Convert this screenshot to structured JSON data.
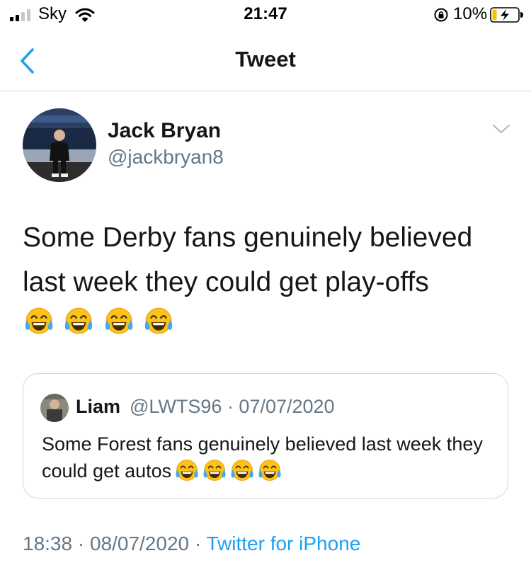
{
  "status_bar": {
    "carrier": "Sky",
    "time": "21:47",
    "battery_percent": "10%",
    "signal_bars": 2,
    "charging": true
  },
  "nav": {
    "title": "Tweet",
    "back_icon": "chevron-left-icon"
  },
  "tweet": {
    "author_name": "Jack Bryan",
    "author_handle": "@jackbryan8",
    "text": "Some Derby fans genuinely believed last week they could get play-offs",
    "emojis": [
      "face-with-tears-of-joy",
      "face-with-tears-of-joy",
      "face-with-tears-of-joy",
      "face-with-tears-of-joy"
    ],
    "timestamp": "18:38 · 08/07/2020 · ",
    "source": "Twitter for iPhone"
  },
  "quoted": {
    "name": "Liam",
    "meta": "@LWTS96 · 07/07/2020",
    "text": "Some Forest fans genuinely believed last week they could get autos",
    "emojis": [
      "face-with-tears-of-joy",
      "face-with-tears-of-joy",
      "face-with-tears-of-joy",
      "face-with-tears-of-joy"
    ]
  },
  "colors": {
    "accent": "#1da1f2",
    "secondary_text": "#657786",
    "border": "#ccd6dd"
  }
}
